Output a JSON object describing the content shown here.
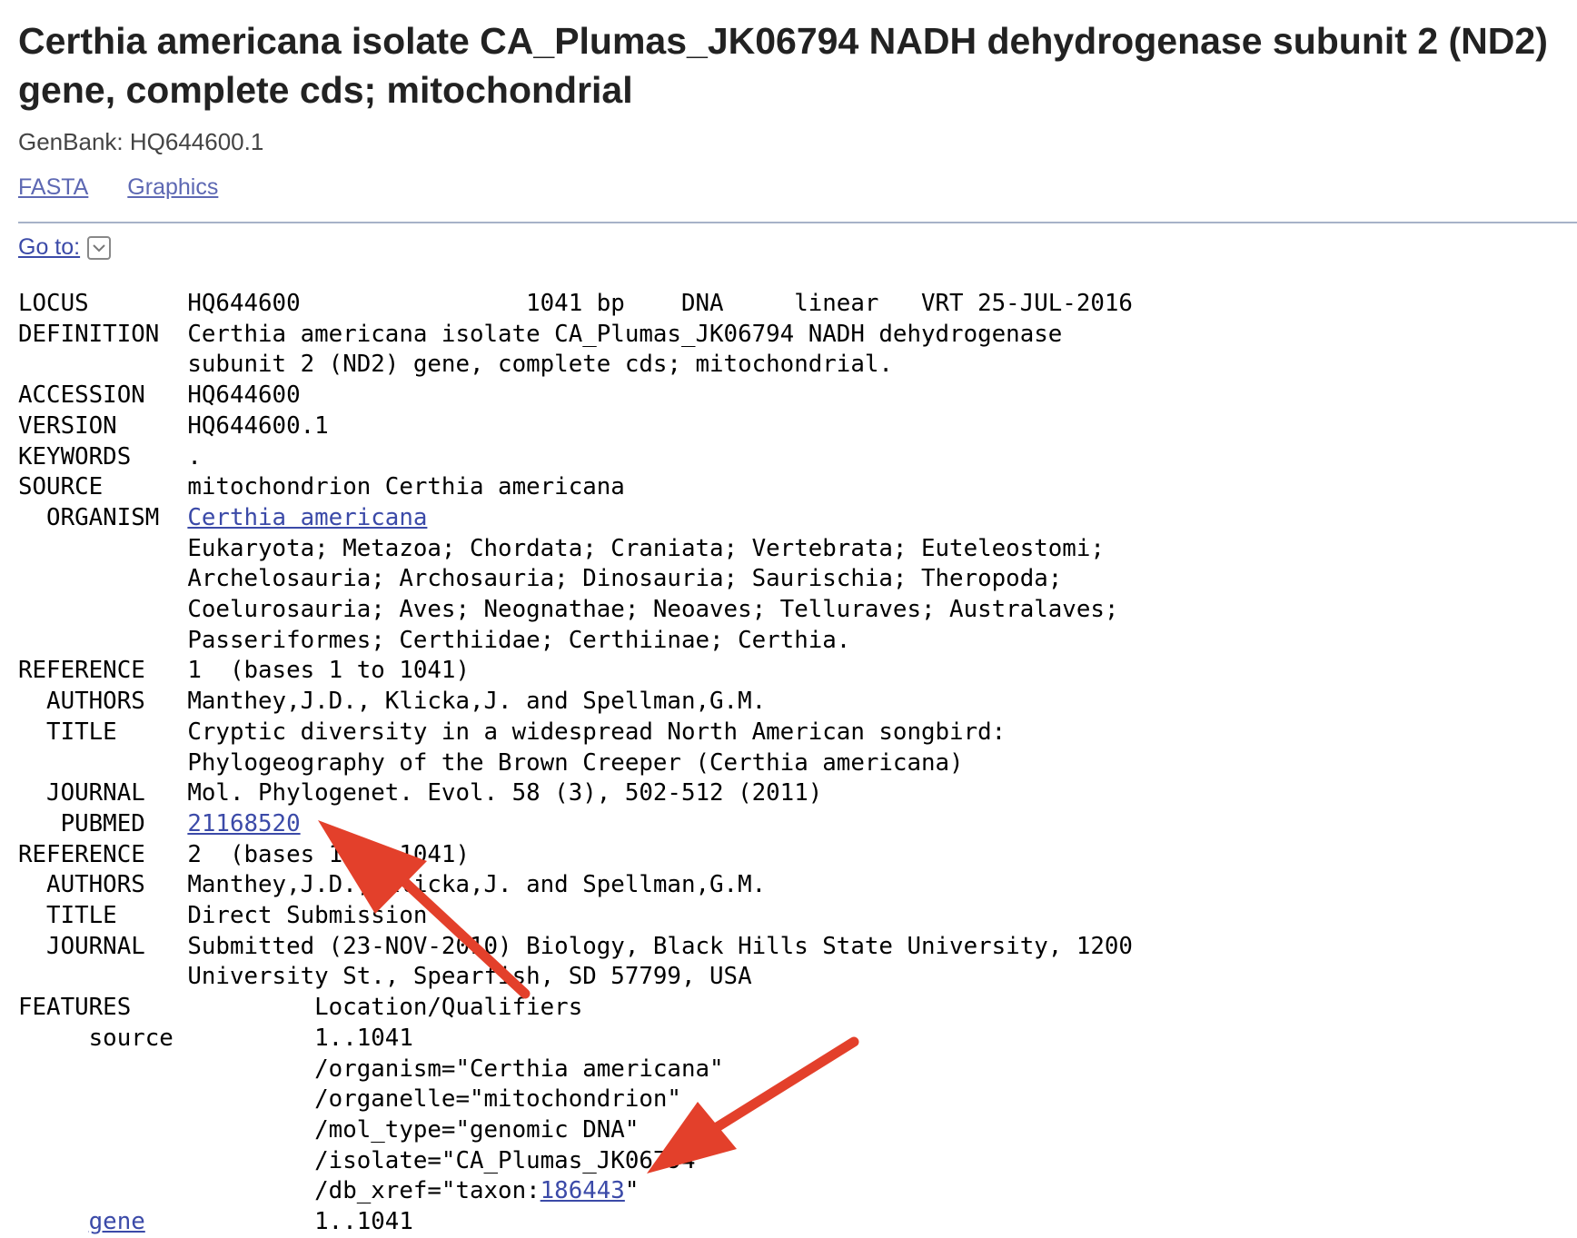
{
  "header": {
    "title": "Certhia americana isolate CA_Plumas_JK06794 NADH dehydrogenase subunit 2 (ND2) gene, complete cds; mitochondrial",
    "accession_label": "GenBank: HQ644600.1"
  },
  "links": {
    "fasta": "FASTA",
    "graphics": "Graphics"
  },
  "goto": {
    "label": "Go to:"
  },
  "record": {
    "locus_label": "LOCUS       ",
    "locus_value": "HQ644600                1041 bp    DNA     linear   VRT 25-JUL-2016\n",
    "definition_label": "DEFINITION  ",
    "definition_value": "Certhia americana isolate CA_Plumas_JK06794 NADH dehydrogenase\n            subunit 2 (ND2) gene, complete cds; mitochondrial.\n",
    "accession_label": "ACCESSION   ",
    "accession_value": "HQ644600\n",
    "version_label": "VERSION     ",
    "version_value": "HQ644600.1\n",
    "keywords_label": "KEYWORDS    ",
    "keywords_value": ".\n",
    "source_label": "SOURCE      ",
    "source_value": "mitochondrion Certhia americana\n",
    "organism_label": "  ORGANISM  ",
    "organism_link": "Certhia americana",
    "lineage": "\n            Eukaryota; Metazoa; Chordata; Craniata; Vertebrata; Euteleostomi;\n            Archelosauria; Archosauria; Dinosauria; Saurischia; Theropoda;\n            Coelurosauria; Aves; Neognathae; Neoaves; Telluraves; Australaves;\n            Passeriformes; Certhiidae; Certhiinae; Certhia.\n",
    "ref1_label": "REFERENCE   ",
    "ref1_value": "1  (bases 1 to 1041)\n",
    "ref1_authors_label": "  AUTHORS   ",
    "ref1_authors": "Manthey,J.D., Klicka,J. and Spellman,G.M.\n",
    "ref1_title_label": "  TITLE     ",
    "ref1_title": "Cryptic diversity in a widespread North American songbird:\n            Phylogeography of the Brown Creeper (Certhia americana)\n",
    "ref1_journal_label": "  JOURNAL   ",
    "ref1_journal": "Mol. Phylogenet. Evol. 58 (3), 502-512 (2011)\n",
    "pubmed_label": "   PUBMED   ",
    "pubmed_link": "21168520",
    "ref2_label": "\nREFERENCE   ",
    "ref2_value": "2  (bases 1 to 1041)\n",
    "ref2_authors_label": "  AUTHORS   ",
    "ref2_authors": "Manthey,J.D., Klicka,J. and Spellman,G.M.\n",
    "ref2_title_label": "  TITLE     ",
    "ref2_title": "Direct Submission\n",
    "ref2_journal_label": "  JOURNAL   ",
    "ref2_journal": "Submitted (23-NOV-2010) Biology, Black Hills State University, 1200\n            University St., Spearfish, SD 57799, USA\n",
    "features_label": "FEATURES             ",
    "features_value": "Location/Qualifiers\n",
    "source_feature_label": "     source          ",
    "source_feature_body": "1..1041\n                     /organism=\"Certhia americana\"\n                     /organelle=\"mitochondrion\"\n                     /mol_type=\"genomic DNA\"\n                     /isolate=\"CA_Plumas_JK06794\"\n                     /db_xref=\"taxon:",
    "taxon_link": "186443",
    "taxon_close": "\"\n",
    "gene_indent": "     ",
    "gene_link": "gene",
    "gene_value": "            1..1041"
  },
  "colors": {
    "link": "#3b4aa8",
    "arrow": "#e3402b",
    "divider": "#a7b2c8"
  }
}
